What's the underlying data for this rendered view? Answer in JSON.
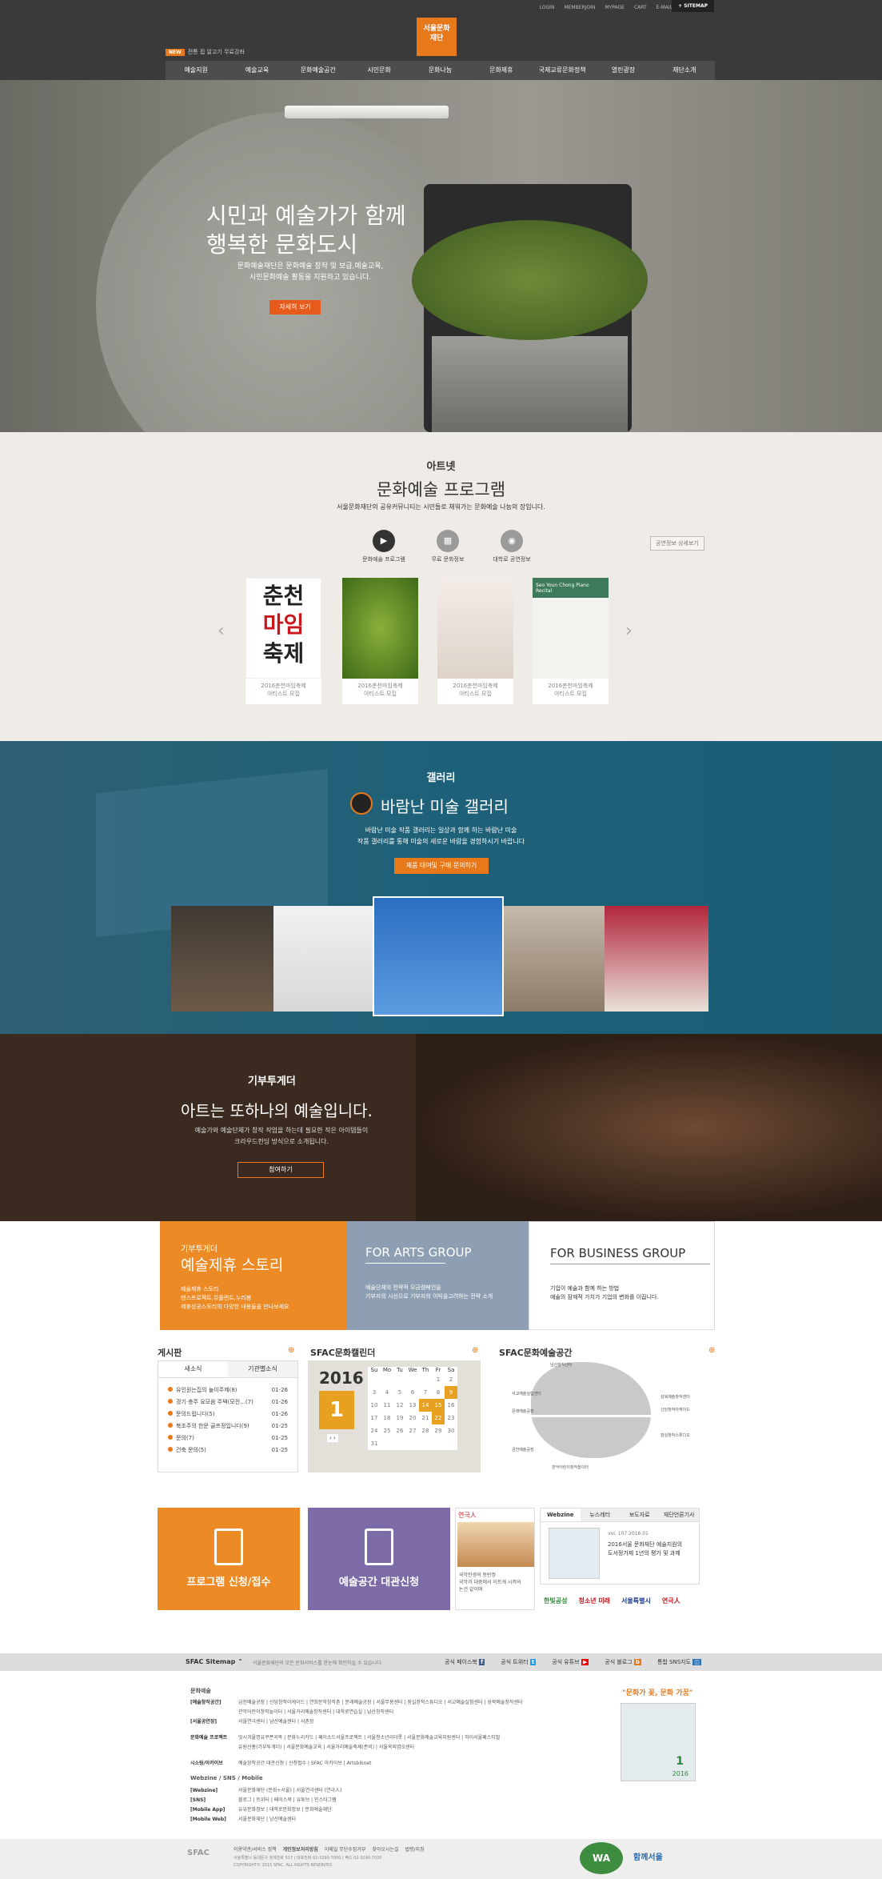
{
  "header": {
    "util_links": [
      "LOGIN",
      "MEMBERJOIN",
      "MYPAGE",
      "CART",
      "E-MAIL"
    ],
    "sitemap_label": "SITEMAP",
    "logo_text": "서울문화재단",
    "logo_sub": "Seoul Foundation for Arts and Culture",
    "notice_badge": "NEW",
    "notice_text": "전통 접 알고기 무료강좌",
    "nav": [
      "예술지원",
      "예술교육",
      "문화예술공간",
      "시민문화",
      "문화나눔",
      "문화제휴",
      "국제교류문화정책",
      "열린광장",
      "재단소개"
    ]
  },
  "hero": {
    "title_line1": "시민과 예술가가 함께",
    "title_line2": "행복한 문화도시",
    "desc_line1": "문화예술재단은 문화예술 창작 및 보급,예술교육,",
    "desc_line2": "시민문화예술 활동을 지원하고 있습니다.",
    "button": "자세히 보기"
  },
  "artnet": {
    "title": "아트넷",
    "subtitle": "문화예술 프로그램",
    "desc": "서울문화재단의 공유커뮤니티는 시민들로 채워가는 문화예술 나눔의 장입니다.",
    "more": "공연정보 상세보기",
    "icons": [
      {
        "label": "문화예술 프로그램",
        "icon": "play-icon",
        "color": "#333333"
      },
      {
        "label": "무료 문화정보",
        "icon": "calendar-icon",
        "color": "#9a9a9a"
      },
      {
        "label": "대학로 공연정보",
        "icon": "camera-icon",
        "color": "#9a9a9a"
      }
    ],
    "cards": [
      {
        "line1": "2016춘천마임축제",
        "line2": "아티스트 모집"
      },
      {
        "line1": "2016춘천마임축제",
        "line2": "아티스트 모집"
      },
      {
        "line1": "2016춘천마임축제",
        "line2": "아티스트 모집"
      },
      {
        "line1": "2016춘천마임축제",
        "line2": "아티스트 모집"
      }
    ],
    "card1_text": "춘천\n마임\n축제",
    "card4_text": "Seo Youn Chong Piano Recital"
  },
  "gallery": {
    "title": "갤러리",
    "subtitle": "바람난 미술 갤러리",
    "desc_line1": "바람난 미술 작품 갤러리는 일상과 함께 하는 바람난 미술",
    "desc_line2": "작품 갤러리를 통해 미술의 새로운 바람을 경험하시기 바랍니다",
    "button": "제품 대여및 구매 문의하기"
  },
  "donate": {
    "title": "기부투게더",
    "subtitle": "아트는 또하나의 예술입니다.",
    "desc_line1": "예술가와 예술단체가 창작 작업을 하는데 필요한 작은 아이템들이",
    "desc_line2": "크라우드펀딩 방식으로 소개됩니다.",
    "button": "참여하기"
  },
  "stories": [
    {
      "kicker": "기부투게더",
      "title": "예술제휴 스토리",
      "desc": "예술제휴 스토리\n댄스프로젝트,뮤플렌트,누리봄\n제휴성공스토리의 다양한 내용들을 만나보세요"
    },
    {
      "title": "FOR ARTS GROUP",
      "desc": "예술단체의 전략적 모금캠페인을\n기부자의 시선으로 기부자의 이익을고려하는 전략 소개"
    },
    {
      "title": "FOR BUSINESS GROUP",
      "desc": "기업이 예술과 함께 하는 방법\n예술의 잠재적 가치가 기업의 변화를 이끕니다."
    }
  ],
  "board": {
    "title": "게시판",
    "tabs": [
      "새소식",
      "기관별소식"
    ],
    "items": [
      {
        "text": "유인원는집의 놀이주제(8)",
        "date": "01-26"
      },
      {
        "text": "경기·충주 요모음 주택(모전...(7)",
        "date": "01-26"
      },
      {
        "text": "문의드립니다(5)",
        "date": "01-26"
      },
      {
        "text": "북조주의 한문 골프정입니다(9)",
        "date": "01-25"
      },
      {
        "text": "문의(7)",
        "date": "01-25"
      },
      {
        "text": "건축 문의(5)",
        "date": "01-25"
      }
    ]
  },
  "calendar": {
    "title": "SFAC문화캘린더",
    "year": "2016",
    "month": "1",
    "weekdays": [
      "Su",
      "Mo",
      "Tu",
      "We",
      "Th",
      "Fr",
      "Sa"
    ],
    "rows": [
      [
        "",
        "",
        "",
        "",
        "",
        "1",
        "2"
      ],
      [
        "3",
        "4",
        "5",
        "6",
        "7",
        "8",
        "9"
      ],
      [
        "10",
        "11",
        "12",
        "13",
        "14",
        "15",
        "16"
      ],
      [
        "17",
        "18",
        "19",
        "20",
        "21",
        "22",
        "23"
      ],
      [
        "24",
        "25",
        "26",
        "27",
        "28",
        "29",
        "30"
      ],
      [
        "31",
        "",
        "",
        "",
        "",
        "",
        ""
      ]
    ],
    "highlight": [
      "9",
      "14",
      "15",
      "22"
    ]
  },
  "spaces": {
    "title": "SFAC문화예술공간",
    "labels": [
      "남산창작센터",
      "남산예술센터",
      "문래예술공장",
      "성북예술창작센터",
      "신당창작아케이드",
      "서교예술실험센터",
      "금천예술공장",
      "관악어린이창작놀이터",
      "연희문학창작촌",
      "서울예술치유허브",
      "홍은예술창작센터",
      "잠실창작스튜디오",
      "서울연극센터",
      "대학로연습실"
    ]
  },
  "tiles": [
    {
      "label": "프로그램 신청/접수",
      "color": "#ec8a25"
    },
    {
      "label": "예술공간 대관신청",
      "color": "#7c6ba7"
    }
  ],
  "promo": {
    "title": "연극人",
    "caption_line1": "국악인생의 동반정",
    "caption_line2": "국악과 대중에서 이트게 시켜의",
    "caption_line3": "논건 같이며"
  },
  "webzine": {
    "tabs": [
      "Webzine",
      "뉴스레터",
      "보도자료",
      "재단언론기사"
    ],
    "vol": "vol. 107 2016.01",
    "desc_line1": "2016서울 문화재단 예술지원의",
    "desc_line2": "도서정가제 1년의 평가 및 과제"
  },
  "logos": [
    "한빛공성",
    "청소년 미래",
    "서울특별시",
    "연극人"
  ],
  "sitemap_bar": {
    "label": "SFAC Sitemap",
    "desc": "서울문화재단의 모든 문화서비스를 한눈에 확인하실 수 있습니다.",
    "links": [
      "공식 페이스북",
      "공식 트위터",
      "공식 유튜브",
      "공식 블로그",
      "통합 SNS지도"
    ]
  },
  "footer_sitemap": {
    "col_title": "문화예술",
    "rows": [
      {
        "head": "[예술창작공간]",
        "items": "금천예술공장 | 신당창작아케이드 | 연희문학창작촌 | 문래예술공장 | 서울무용센터 | 잠실창작스튜디오 | 서교예술실험센터 | 성북예술창작센터"
      },
      {
        "head": "",
        "items": "관악어린이창작놀이터 | 서울거리예술창작센터 | 대학로연습실 | 남산창작센터"
      },
      {
        "head": "[서울공연장]",
        "items": "서울연극센터 | 남산예술센터 | 서촌장"
      },
      {
        "head": "문화예술 프로젝트",
        "items": "잇시겨울명유쿠폰곡목 | 문화누리카드 | 페이소드서울프로젝트 | 서울청소년리더롯 | 서울문화예술교육지원센터 | 하이서울페스티벌"
      },
      {
        "head": "",
        "items": "유원선홍(가부투게더) | 서울문화예술교육 | 서울거리예술축제(준비) | 서울옥외엽오센터"
      },
      {
        "head": "시소링/아카이브",
        "items": "예술창작공간 대관신청 | 신청접수 | SFAC 아카이브 | Artsbiknet"
      }
    ],
    "webzine_title": "Webzine / SNS / Mobile",
    "webzine_rows": [
      {
        "head": "[Webzine]",
        "items": "서울문화재단 (문화+서울) | 서울연극센터 (연극人)"
      },
      {
        "head": "[SNS]",
        "items": "블로그 | 트위터 | 페이스북 | 유튜브 | 인스타그램"
      },
      {
        "head": "[Mobile App]",
        "items": "유유문화정보 | 대학로문화정보 | 문화예술재단"
      },
      {
        "head": "[Mobile Web]",
        "items": "서울문화재단 | 남산예술센터"
      }
    ],
    "magazine_title": "\"문화가 꽃, 문화 가꿈\"",
    "magazine_num": "1",
    "magazine_year": "2016"
  },
  "bottom": {
    "links": [
      "이용약관/서비스 정책",
      "개인정보처리방침",
      "이메일 무단수집거부",
      "찾아오시는길",
      "법령/지침"
    ],
    "address": "서울특별시 동대문구 청계천로 517 | 대표전화 02-3290-7000 | 팩스 02-3290-7020",
    "copyright": "COPYRIGHT© 2015 SFAC. ALL RIGHTS RESERVED.",
    "badges": [
      "WA 웹접근성 품질인증마크",
      "함께서울"
    ]
  }
}
